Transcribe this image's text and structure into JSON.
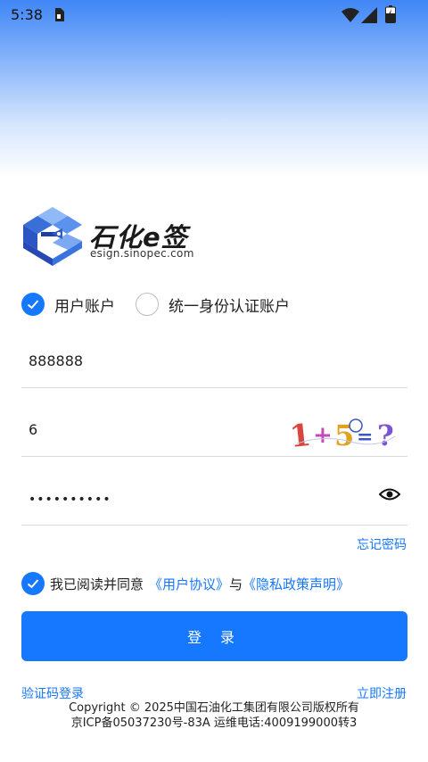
{
  "status_bar": {
    "time": "5:38"
  },
  "brand": {
    "name": "石化e签",
    "domain": "esign.sinopec.com",
    "accent": "#1677ff"
  },
  "account_type": {
    "options": [
      {
        "label": "用户账户",
        "checked": true
      },
      {
        "label": "统一身份认证账户",
        "checked": false
      }
    ]
  },
  "form": {
    "username_value": "888888",
    "captcha_value": "6",
    "captcha_image_text": "1+5=?",
    "password_value": "••••••••••"
  },
  "links": {
    "forgot_password": "忘记密码",
    "sms_login": "验证码登录",
    "register": "立即注册"
  },
  "agreement": {
    "checked": true,
    "prefix": "我已阅读并同意",
    "user_agreement": "《用户协议》",
    "joiner": "与",
    "privacy_policy": "《隐私政策声明》"
  },
  "login_button": "登 录",
  "footer": {
    "copyright": "Copyright © 2025中国石油化工集团有限公司版权所有",
    "icp": "京ICP备05037230号-83A 运维电话:4009199000转3"
  }
}
